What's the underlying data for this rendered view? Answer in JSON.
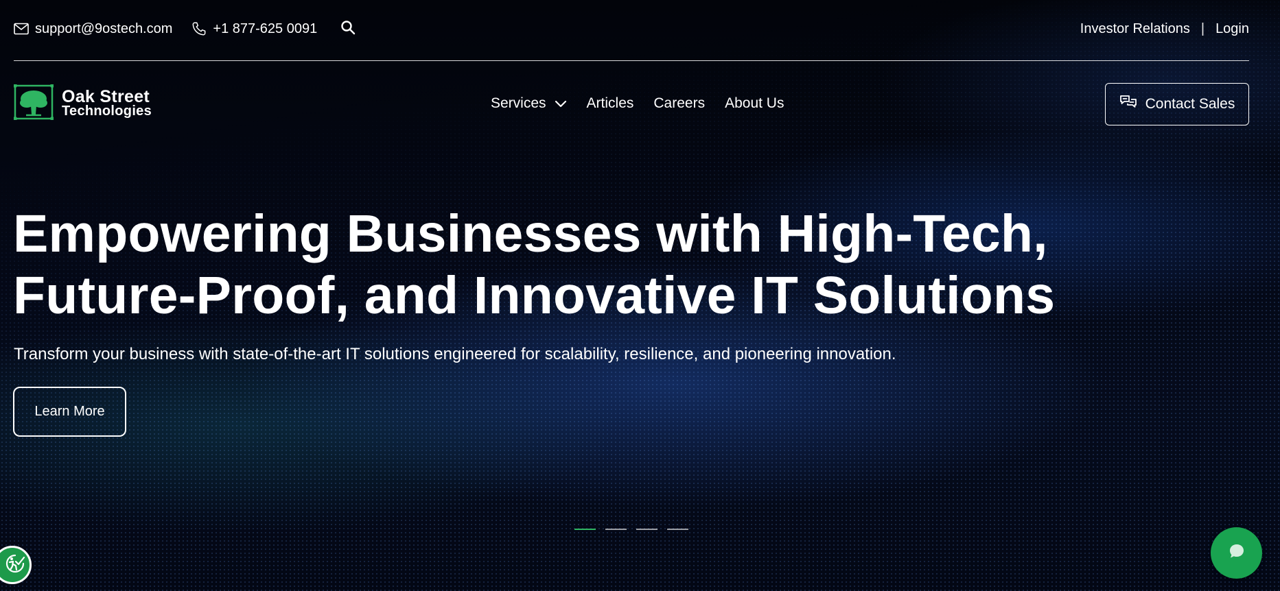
{
  "colors": {
    "accent_green": "#19a350",
    "background": "#03050b",
    "text": "#ffffff"
  },
  "topbar": {
    "email": "support@9ostech.com",
    "phone": "+1 877-625 0091",
    "email_icon": "mail-icon",
    "phone_icon": "phone-icon",
    "search_icon": "search-icon",
    "investor_relations": "Investor Relations",
    "separator": "|",
    "login": "Login"
  },
  "logo": {
    "line1": "Oak Street",
    "line2": "Technologies",
    "icon": "oak-tree-icon"
  },
  "nav": {
    "items": [
      {
        "label": "Services",
        "has_dropdown": true
      },
      {
        "label": "Articles"
      },
      {
        "label": "Careers"
      },
      {
        "label": "About Us"
      }
    ],
    "contact_sales": "Contact Sales",
    "contact_sales_icon": "chat-bubbles-icon"
  },
  "hero": {
    "title_line1": "Empowering Businesses with High-Tech,",
    "title_line2": "Future-Proof, and Innovative IT Solutions",
    "subtitle": "Transform your business with state-of-the-art IT solutions engineered for scalability, resilience, and pioneering innovation.",
    "cta": "Learn More"
  },
  "slider": {
    "count": 4,
    "active_index": 0
  },
  "floating": {
    "accessibility_icon": "accessibility-icon",
    "chat_icon": "chat-icon"
  }
}
